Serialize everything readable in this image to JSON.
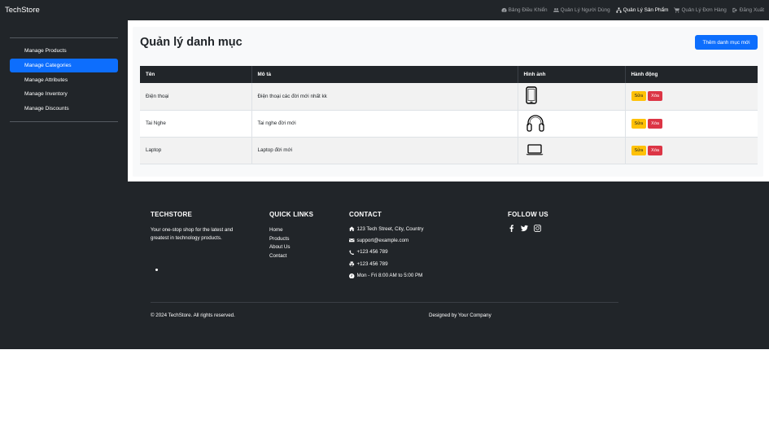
{
  "app": {
    "brand": "TechStore"
  },
  "topnav": {
    "items": [
      {
        "label": "Bảng Điều Khiển",
        "icon": "dashboard-icon",
        "active": false
      },
      {
        "label": "Quản Lý Người Dùng",
        "icon": "users-icon",
        "active": false
      },
      {
        "label": "Quản Lý Sản Phẩm",
        "icon": "sitemap-icon",
        "active": true
      },
      {
        "label": "Quản Lý Đơn Hàng",
        "icon": "cart-icon",
        "active": false
      },
      {
        "label": "Đăng Xuất",
        "icon": "logout-icon",
        "active": false
      }
    ]
  },
  "sidebar": {
    "items": [
      {
        "label": "Manage Products",
        "active": false
      },
      {
        "label": "Manage Categories",
        "active": true
      },
      {
        "label": "Manage Attributes",
        "active": false
      },
      {
        "label": "Manage Inventory",
        "active": false
      },
      {
        "label": "Manage Discounts",
        "active": false
      }
    ]
  },
  "main": {
    "title": "Quản lý danh mục",
    "add_button": "Thêm danh mục mới",
    "table": {
      "headers": [
        "Tên",
        "Mô tả",
        "Hình ảnh",
        "Hành động"
      ],
      "rows": [
        {
          "name": "Điện thoại",
          "description": "Điện thoại các đời mới nhất kk",
          "image": "phone-icon"
        },
        {
          "name": "Tai Nghe",
          "description": "Tai nghe đời mới",
          "image": "headphones-icon"
        },
        {
          "name": "Laptop",
          "description": "Laptop đời mới",
          "image": "laptop-icon"
        }
      ],
      "edit_label": "Sửa",
      "delete_label": "Xóa"
    }
  },
  "footer": {
    "about": {
      "heading": "TECHSTORE",
      "text": "Your one-stop shop for the latest and greatest in technology products."
    },
    "quick_links": {
      "heading": "QUICK LINKS",
      "links": [
        "Home",
        "Products",
        "About Us",
        "Contact"
      ]
    },
    "contact": {
      "heading": "CONTACT",
      "address": "123 Tech Street, City, Country",
      "email": "support@example.com",
      "phone": "+123 456 789",
      "fax": "+123 456 789",
      "hours": "Mon - Fri 8:00 AM to 5:00 PM"
    },
    "follow": {
      "heading": "FOLLOW US",
      "icons": [
        "facebook-icon",
        "twitter-icon",
        "instagram-icon"
      ]
    },
    "copyright": "© 2024 TechStore. All rights reserved.",
    "designed_by": "Designed by Your Company"
  },
  "colors": {
    "primary": "#0d6efd",
    "dark": "#212529",
    "warning": "#ffc107",
    "danger": "#dc3545"
  }
}
